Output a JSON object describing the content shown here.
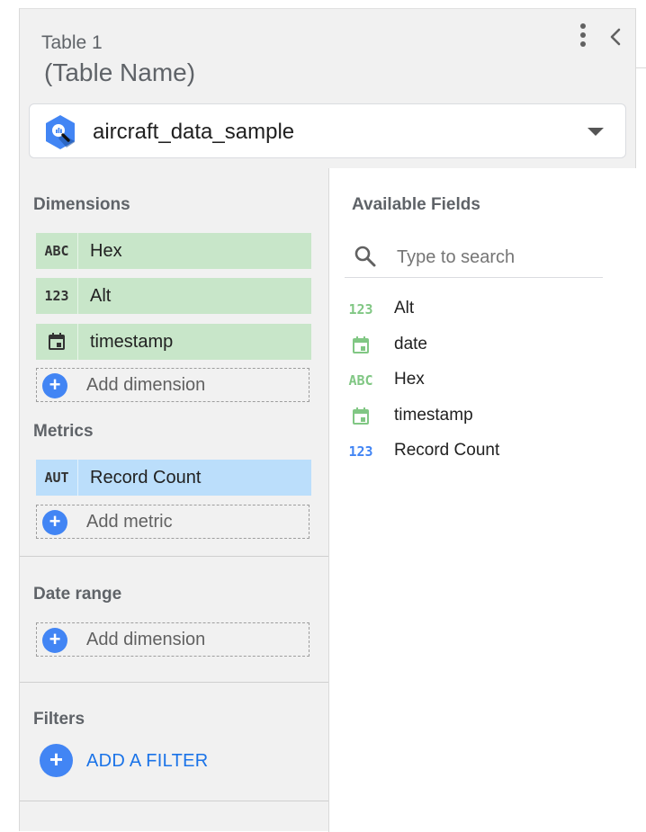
{
  "panel": {
    "title_line1": "Table 1",
    "title_line2": "(Table Name)",
    "more_icon": "more-vert-icon",
    "collapse_icon": "chevron-left-icon"
  },
  "data_source": {
    "name": "aircraft_data_sample",
    "icon": "bigquery-icon"
  },
  "dimensions": {
    "title": "Dimensions",
    "items": [
      {
        "type": "ABC",
        "label": "Hex"
      },
      {
        "type": "123",
        "label": "Alt"
      },
      {
        "type": "calendar-icon",
        "label": "timestamp"
      }
    ],
    "add_label": "Add dimension"
  },
  "metrics": {
    "title": "Metrics",
    "items": [
      {
        "type": "AUT",
        "label": "Record Count"
      }
    ],
    "add_label": "Add metric"
  },
  "date_range": {
    "title": "Date range",
    "add_label": "Add dimension"
  },
  "filters": {
    "title": "Filters",
    "add_label": "ADD A FILTER"
  },
  "available": {
    "title": "Available Fields",
    "search_placeholder": "Type to search",
    "fields": [
      {
        "type": "123",
        "label": "Alt",
        "color": "#81c784"
      },
      {
        "type": "calendar-icon",
        "label": "date",
        "color": "#81c784"
      },
      {
        "type": "ABC",
        "label": "Hex",
        "color": "#81c784"
      },
      {
        "type": "calendar-icon",
        "label": "timestamp",
        "color": "#81c784"
      },
      {
        "type": "123",
        "label": "Record Count",
        "color": "#4285f4"
      }
    ]
  },
  "colors": {
    "dimension_chip": "#c8e6c9",
    "metric_chip": "#bbdefb",
    "accent": "#4285f4",
    "link": "#1a73e8"
  }
}
